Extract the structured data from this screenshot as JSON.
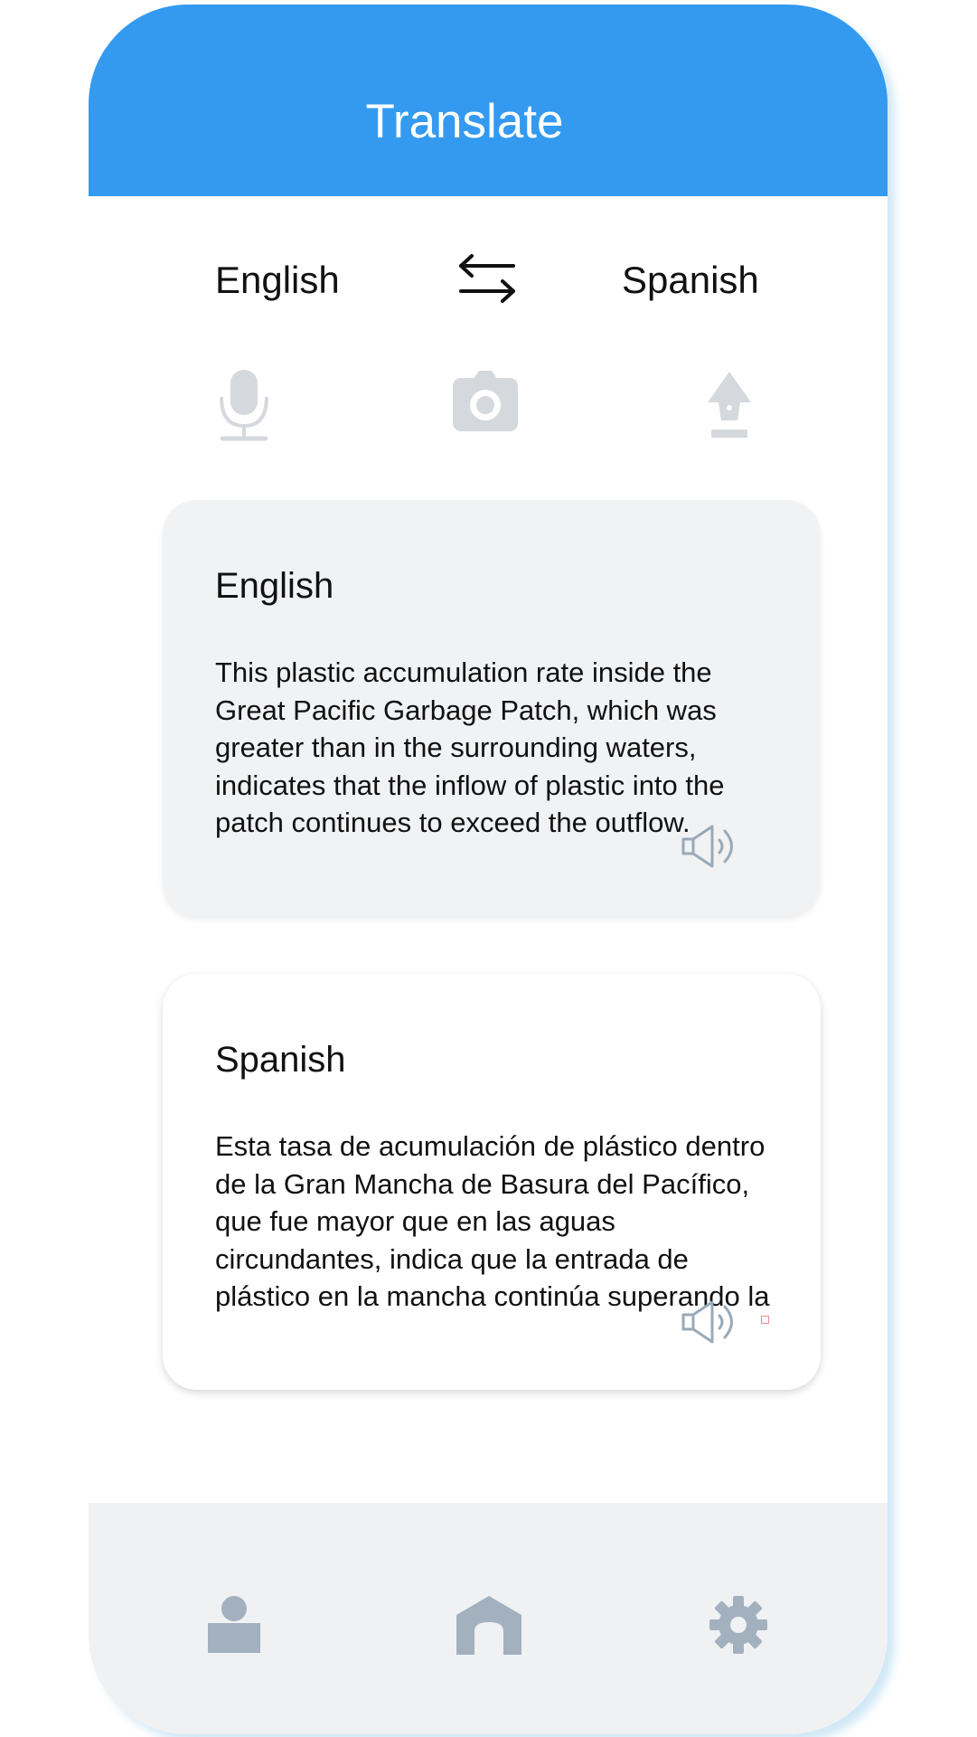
{
  "header": {
    "title": "Translate",
    "background_color": "#339af0"
  },
  "language_bar": {
    "source_language": "English",
    "target_language": "Spanish",
    "swap_icon": "swap-arrows-icon"
  },
  "input_tools": [
    {
      "icon": "microphone-icon"
    },
    {
      "icon": "camera-icon"
    },
    {
      "icon": "pen-icon"
    }
  ],
  "source_card": {
    "label": "English",
    "text": "This plastic accumulation rate inside the Great Pacific Garbage Patch, which was greater than in the surrounding waters, indicates that the inflow of plastic into the patch continues to exceed the outflow.",
    "speaker_icon": "speaker-icon",
    "background_color": "#f1f2f4"
  },
  "target_card": {
    "label": "Spanish",
    "text": "Esta tasa de acumulación de plástico dentro de la Gran Mancha de Basura del Pacífico, que fue mayor que en las aguas circundantes, indica que la entrada de plástico en la mancha continúa superando la salida.",
    "speaker_icon": "speaker-icon",
    "background_color": "#ffffff"
  },
  "bottom_nav": [
    {
      "icon": "user-icon"
    },
    {
      "icon": "home-icon"
    },
    {
      "icon": "gear-icon"
    }
  ],
  "colors": {
    "icon_light": "#d5d8dc",
    "icon_nav": "#a3b1bf",
    "speaker_stroke": "#9aa9b6",
    "bottom_bar": "#eff1f3"
  }
}
